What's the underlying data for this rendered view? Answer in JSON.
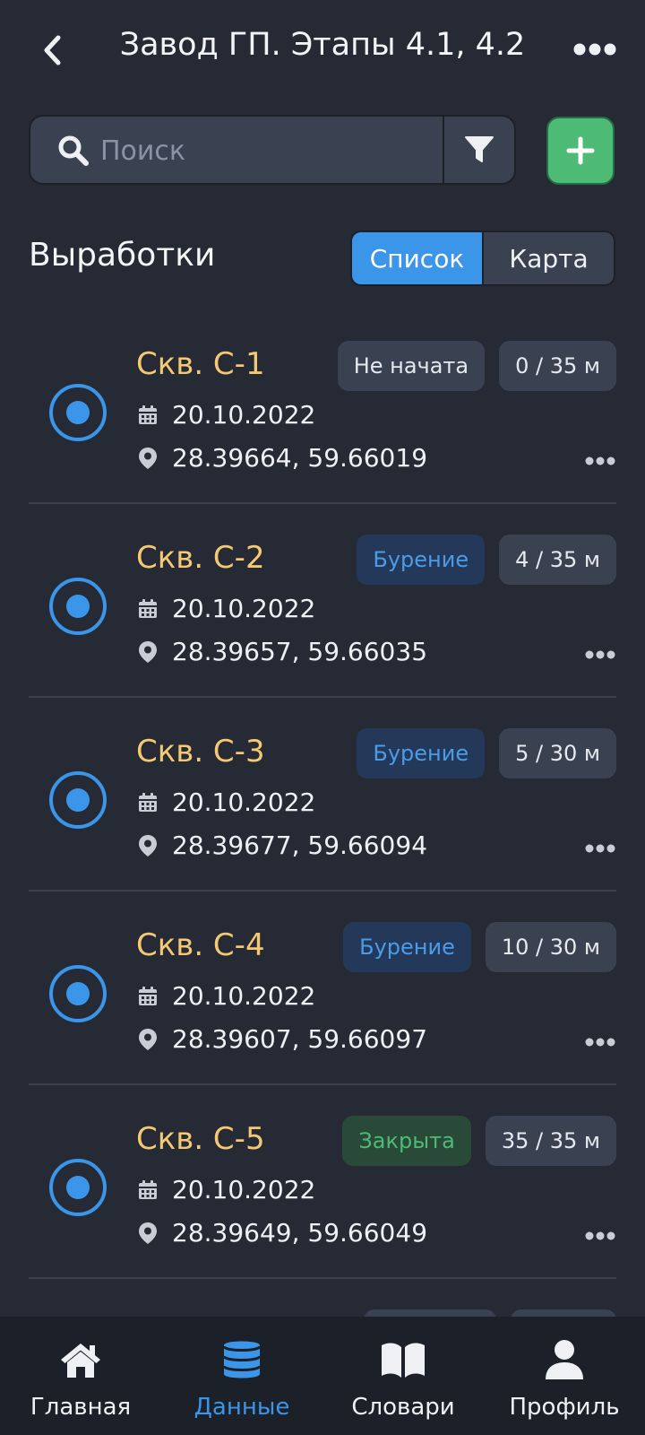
{
  "header": {
    "title": "Завод ГП. Этапы 4.1, 4.2"
  },
  "search": {
    "placeholder": "Поиск",
    "value": ""
  },
  "section": {
    "title": "Выработки"
  },
  "view_toggle": {
    "list_label": "Список",
    "map_label": "Карта",
    "selected": "Список"
  },
  "items": [
    {
      "name": "Скв. С-1",
      "status": "Не начата",
      "progress": "0 / 35 м",
      "date": "20.10.2022",
      "coords": "28.39664, 59.66019"
    },
    {
      "name": "Скв. С-2",
      "status": "Бурение",
      "progress": "4 / 35 м",
      "date": "20.10.2022",
      "coords": "28.39657, 59.66035"
    },
    {
      "name": "Скв. С-3",
      "status": "Бурение",
      "progress": "5 / 30 м",
      "date": "20.10.2022",
      "coords": "28.39677, 59.66094"
    },
    {
      "name": "Скв. С-4",
      "status": "Бурение",
      "progress": "10 / 30 м",
      "date": "20.10.2022",
      "coords": "28.39607, 59.66097"
    },
    {
      "name": "Скв. С-5",
      "status": "Закрыта",
      "progress": "35 / 35 м",
      "date": "20.10.2022",
      "coords": "28.39649, 59.66049"
    }
  ],
  "tabs": [
    {
      "label": "Главная",
      "icon": "home-icon"
    },
    {
      "label": "Данные",
      "icon": "database-icon",
      "active": true
    },
    {
      "label": "Словари",
      "icon": "book-icon"
    },
    {
      "label": "Профиль",
      "icon": "user-icon"
    }
  ],
  "colors": {
    "background": "#252a34",
    "accent": "#3b95e8",
    "add_button": "#4dba76",
    "item_title": "#f5c973",
    "tabbar": "#1c2029"
  }
}
